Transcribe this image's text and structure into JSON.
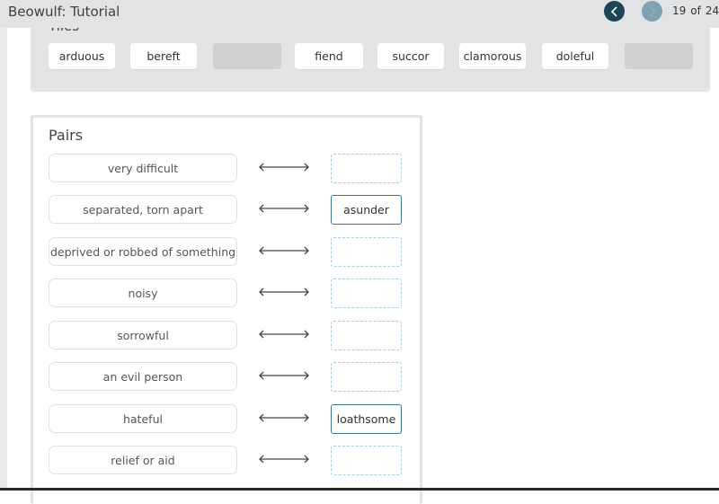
{
  "header": {
    "title": "Beowulf: Tutorial",
    "nav_prev_icon": "chevron-left-icon",
    "nav_next_icon": "chevron-right-icon",
    "page_current": "19",
    "page_of": "of",
    "page_total": "24",
    "prev_color": "#1d4457",
    "next_color": "#7fa1b2"
  },
  "tiles": {
    "heading": "Tiles",
    "items": [
      {
        "label": "arduous",
        "empty": false
      },
      {
        "label": "bereft",
        "empty": false
      },
      {
        "label": "",
        "empty": true
      },
      {
        "label": "fiend",
        "empty": false
      },
      {
        "label": "succor",
        "empty": false
      },
      {
        "label": "clamorous",
        "empty": false
      },
      {
        "label": "doleful",
        "empty": false
      },
      {
        "label": "",
        "empty": true
      }
    ]
  },
  "pairs": {
    "heading": "Pairs",
    "arrow_icon": "double-arrow-icon",
    "rows": [
      {
        "definition": "very difficult",
        "answer": ""
      },
      {
        "definition": "separated, torn apart",
        "answer": "asunder"
      },
      {
        "definition": "deprived or robbed of something",
        "answer": ""
      },
      {
        "definition": "noisy",
        "answer": ""
      },
      {
        "definition": "sorrowful",
        "answer": ""
      },
      {
        "definition": "an evil person",
        "answer": ""
      },
      {
        "definition": "hateful",
        "answer": "loathsome"
      },
      {
        "definition": "relief or aid",
        "answer": ""
      }
    ]
  }
}
